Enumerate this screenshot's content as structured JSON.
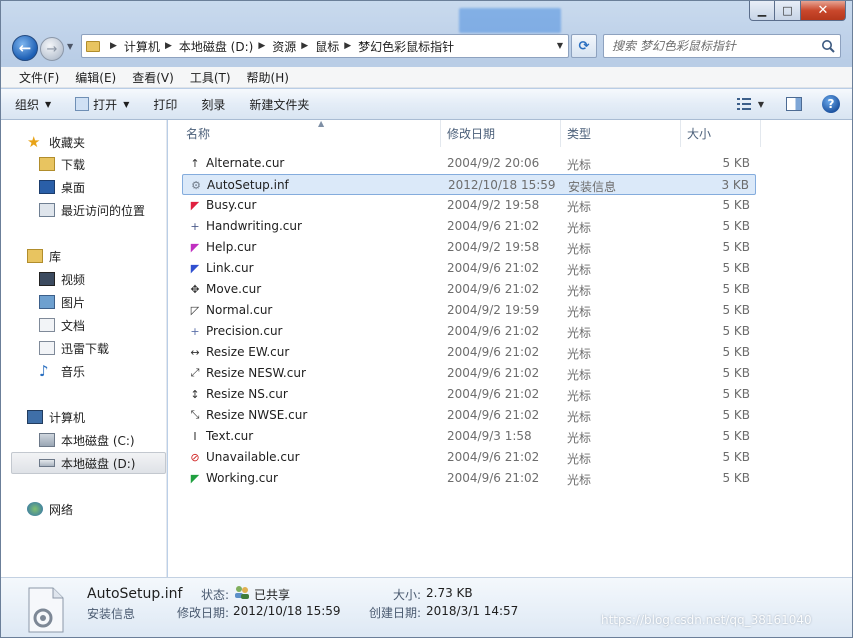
{
  "window": {
    "address": {
      "crumbs": [
        "计算机",
        "本地磁盘 (D:)",
        "资源",
        "鼠标",
        "梦幻色彩鼠标指针"
      ]
    },
    "search": {
      "placeholder": "搜索 梦幻色彩鼠标指针"
    }
  },
  "menubar": {
    "items": [
      "文件(F)",
      "编辑(E)",
      "查看(V)",
      "工具(T)",
      "帮助(H)"
    ]
  },
  "commandbar": {
    "organize": "组织",
    "open": "打开",
    "burn": "刻录",
    "record": "刻录",
    "print": "打印",
    "new_folder": "新建文件夹"
  },
  "navpane": {
    "favorites": {
      "header": "收藏夹",
      "items": [
        "下载",
        "桌面",
        "最近访问的位置"
      ]
    },
    "libraries": {
      "header": "库",
      "items": [
        "视频",
        "图片",
        "文档",
        "迅雷下载",
        "音乐"
      ]
    },
    "computer": {
      "header": "计算机",
      "items": [
        "本地磁盘 (C:)",
        "本地磁盘 (D:)"
      ]
    },
    "network": {
      "header": "网络"
    }
  },
  "filelist": {
    "columns": [
      "名称",
      "修改日期",
      "类型",
      "大小"
    ],
    "rows": [
      {
        "name": "Alternate.cur",
        "date": "2004/9/2 20:06",
        "type": "光标",
        "size": "5 KB",
        "icon": "cursor-alternate-icon",
        "glyph": "↑",
        "color": "#333333"
      },
      {
        "name": "AutoSetup.inf",
        "date": "2012/10/18 15:59",
        "type": "安装信息",
        "size": "3 KB",
        "icon": "setup-info-icon",
        "glyph": "⚙",
        "color": "#6f7a88"
      },
      {
        "name": "Busy.cur",
        "date": "2004/9/2 19:58",
        "type": "光标",
        "size": "5 KB",
        "icon": "cursor-busy-icon",
        "glyph": "◤",
        "color": "#e02040"
      },
      {
        "name": "Handwriting.cur",
        "date": "2004/9/6 21:02",
        "type": "光标",
        "size": "5 KB",
        "icon": "cursor-handwriting-icon",
        "glyph": "+",
        "color": "#4a5a8a"
      },
      {
        "name": "Help.cur",
        "date": "2004/9/2 19:58",
        "type": "光标",
        "size": "5 KB",
        "icon": "cursor-help-icon",
        "glyph": "◤",
        "color": "#c030c0"
      },
      {
        "name": "Link.cur",
        "date": "2004/9/6 21:02",
        "type": "光标",
        "size": "5 KB",
        "icon": "cursor-link-icon",
        "glyph": "◤",
        "color": "#3050d0"
      },
      {
        "name": "Move.cur",
        "date": "2004/9/6 21:02",
        "type": "光标",
        "size": "5 KB",
        "icon": "cursor-move-icon",
        "glyph": "✥",
        "color": "#333333"
      },
      {
        "name": "Normal.cur",
        "date": "2004/9/2 19:59",
        "type": "光标",
        "size": "5 KB",
        "icon": "cursor-normal-icon",
        "glyph": "◸",
        "color": "#333333"
      },
      {
        "name": "Precision.cur",
        "date": "2004/9/6 21:02",
        "type": "光标",
        "size": "5 KB",
        "icon": "cursor-precision-icon",
        "glyph": "+",
        "color": "#5a6fa8"
      },
      {
        "name": "Resize EW.cur",
        "date": "2004/9/6 21:02",
        "type": "光标",
        "size": "5 KB",
        "icon": "cursor-resize-ew-icon",
        "glyph": "↔",
        "color": "#333333"
      },
      {
        "name": "Resize NESW.cur",
        "date": "2004/9/6 21:02",
        "type": "光标",
        "size": "5 KB",
        "icon": "cursor-resize-nesw-icon",
        "glyph": "⤢",
        "color": "#333333"
      },
      {
        "name": "Resize NS.cur",
        "date": "2004/9/6 21:02",
        "type": "光标",
        "size": "5 KB",
        "icon": "cursor-resize-ns-icon",
        "glyph": "↕",
        "color": "#333333"
      },
      {
        "name": "Resize NWSE.cur",
        "date": "2004/9/6 21:02",
        "type": "光标",
        "size": "5 KB",
        "icon": "cursor-resize-nwse-icon",
        "glyph": "⤡",
        "color": "#333333"
      },
      {
        "name": "Text.cur",
        "date": "2004/9/3 1:58",
        "type": "光标",
        "size": "5 KB",
        "icon": "cursor-text-icon",
        "glyph": "I",
        "color": "#333333"
      },
      {
        "name": "Unavailable.cur",
        "date": "2004/9/6 21:02",
        "type": "光标",
        "size": "5 KB",
        "icon": "cursor-unavailable-icon",
        "glyph": "⊘",
        "color": "#d02020"
      },
      {
        "name": "Working.cur",
        "date": "2004/9/6 21:02",
        "type": "光标",
        "size": "5 KB",
        "icon": "cursor-working-icon",
        "glyph": "◤",
        "color": "#20a040"
      }
    ],
    "selected_index": 1
  },
  "details": {
    "name": "AutoSetup.inf",
    "type": "安装信息",
    "status_label": "状态:",
    "status_value": "已共享",
    "size_label": "大小:",
    "size_value": "2.73 KB",
    "modified_label": "修改日期:",
    "modified_value": "2012/10/18 15:59",
    "created_label": "创建日期:",
    "created_value": "2018/3/1 14:57"
  },
  "watermark": "https://blog.csdn.net/qq_38161040",
  "colors": {
    "selection_bg": "#dbe9f9",
    "selection_border": "#84acdd",
    "header_text": "#4c607a",
    "muted_text": "#6d6d6d"
  }
}
